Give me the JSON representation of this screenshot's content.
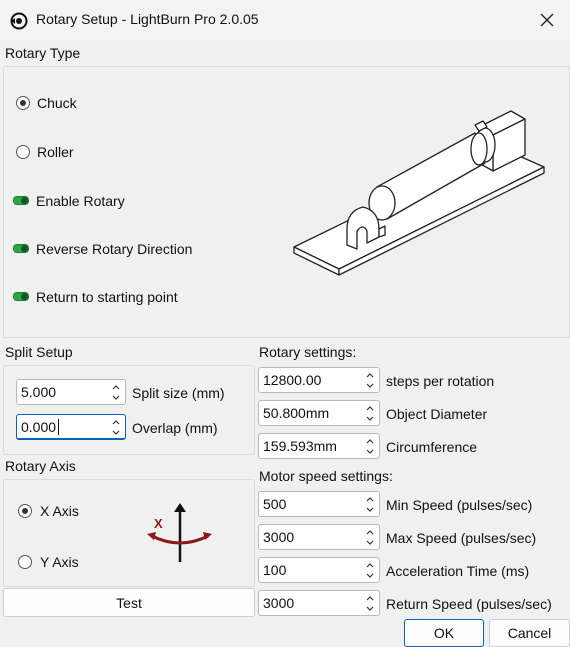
{
  "window": {
    "title": "Rotary Setup - LightBurn Pro 2.0.05"
  },
  "rotary_type": {
    "group_label": "Rotary Type",
    "chuck_label": "Chuck",
    "roller_label": "Roller",
    "selected": "Chuck",
    "enable_rotary": {
      "label": "Enable Rotary",
      "enabled": true
    },
    "reverse_direction": {
      "label": "Reverse Rotary Direction",
      "enabled": true
    },
    "return_to_start": {
      "label": "Return to starting point",
      "enabled": true
    }
  },
  "split_setup": {
    "group_label": "Split Setup",
    "split_size": {
      "value": "5.000",
      "label": "Split size (mm)"
    },
    "overlap": {
      "value": "0.000",
      "label": "Overlap (mm)"
    }
  },
  "rotary_axis": {
    "group_label": "Rotary Axis",
    "x_label": "X Axis",
    "y_label": "Y Axis",
    "selected": "X Axis",
    "diagram_letter": "X"
  },
  "rotary_settings": {
    "group_label": "Rotary settings:",
    "steps": {
      "value": "12800.00",
      "label": "steps per rotation"
    },
    "diameter": {
      "value": "50.800mm",
      "label": "Object Diameter"
    },
    "circumference": {
      "value": "159.593mm",
      "label": "Circumference"
    }
  },
  "motor_speed": {
    "group_label": "Motor speed settings:",
    "min_speed": {
      "value": "500",
      "label": "Min Speed (pulses/sec)"
    },
    "max_speed": {
      "value": "3000",
      "label": "Max Speed (pulses/sec)"
    },
    "accel_time": {
      "value": "100",
      "label": "Acceleration Time (ms)"
    },
    "return_speed": {
      "value": "3000",
      "label": "Return Speed (pulses/sec)"
    }
  },
  "buttons": {
    "test": "Test",
    "ok": "OK",
    "cancel": "Cancel"
  },
  "colors": {
    "toggle_on": "#2aa84a",
    "accent": "#0a64b4",
    "arrow_red": "#8b1a1a"
  }
}
